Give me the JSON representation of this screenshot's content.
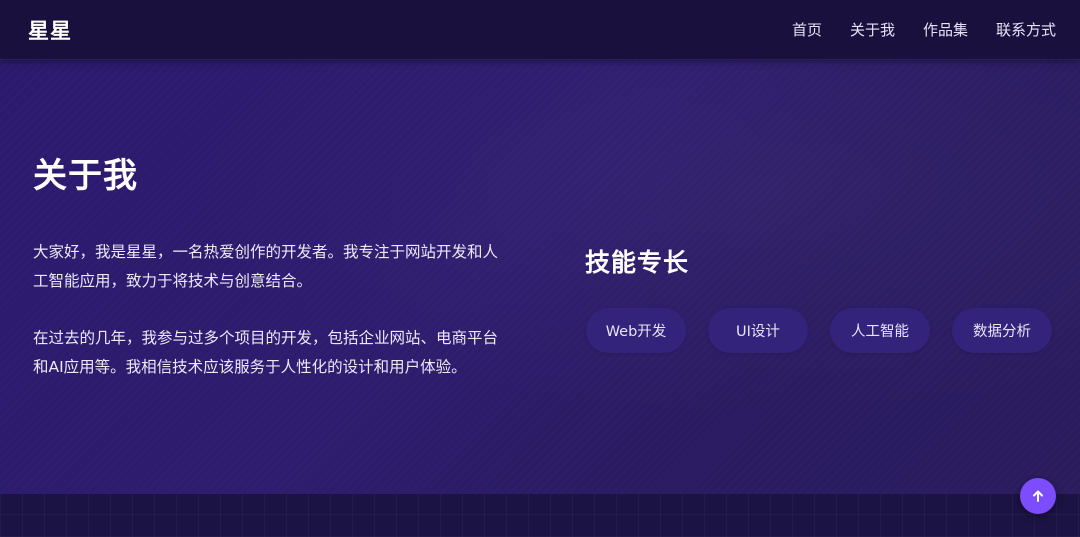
{
  "nav": {
    "brand": "星星",
    "links": [
      "首页",
      "关于我",
      "作品集",
      "联系方式"
    ]
  },
  "about": {
    "title": "关于我",
    "paragraphs": [
      "大家好，我是星星，一名热爱创作的开发者。我专注于网站开发和人工智能应用，致力于将技术与创意结合。",
      "在过去的几年，我参与过多个项目的开发，包括企业网站、电商平台和AI应用等。我相信技术应该服务于人性化的设计和用户体验。"
    ]
  },
  "skills": {
    "title": "技能专长",
    "items": [
      "Web开发",
      "UI设计",
      "人工智能",
      "数据分析"
    ]
  },
  "back_to_top": {
    "icon": "arrow-up-icon"
  },
  "colors": {
    "nav_bg": "#19103d",
    "section_bg": "#2b1a6e",
    "skill_tag_bg": "#33237a",
    "accent": "#7c4dff"
  }
}
